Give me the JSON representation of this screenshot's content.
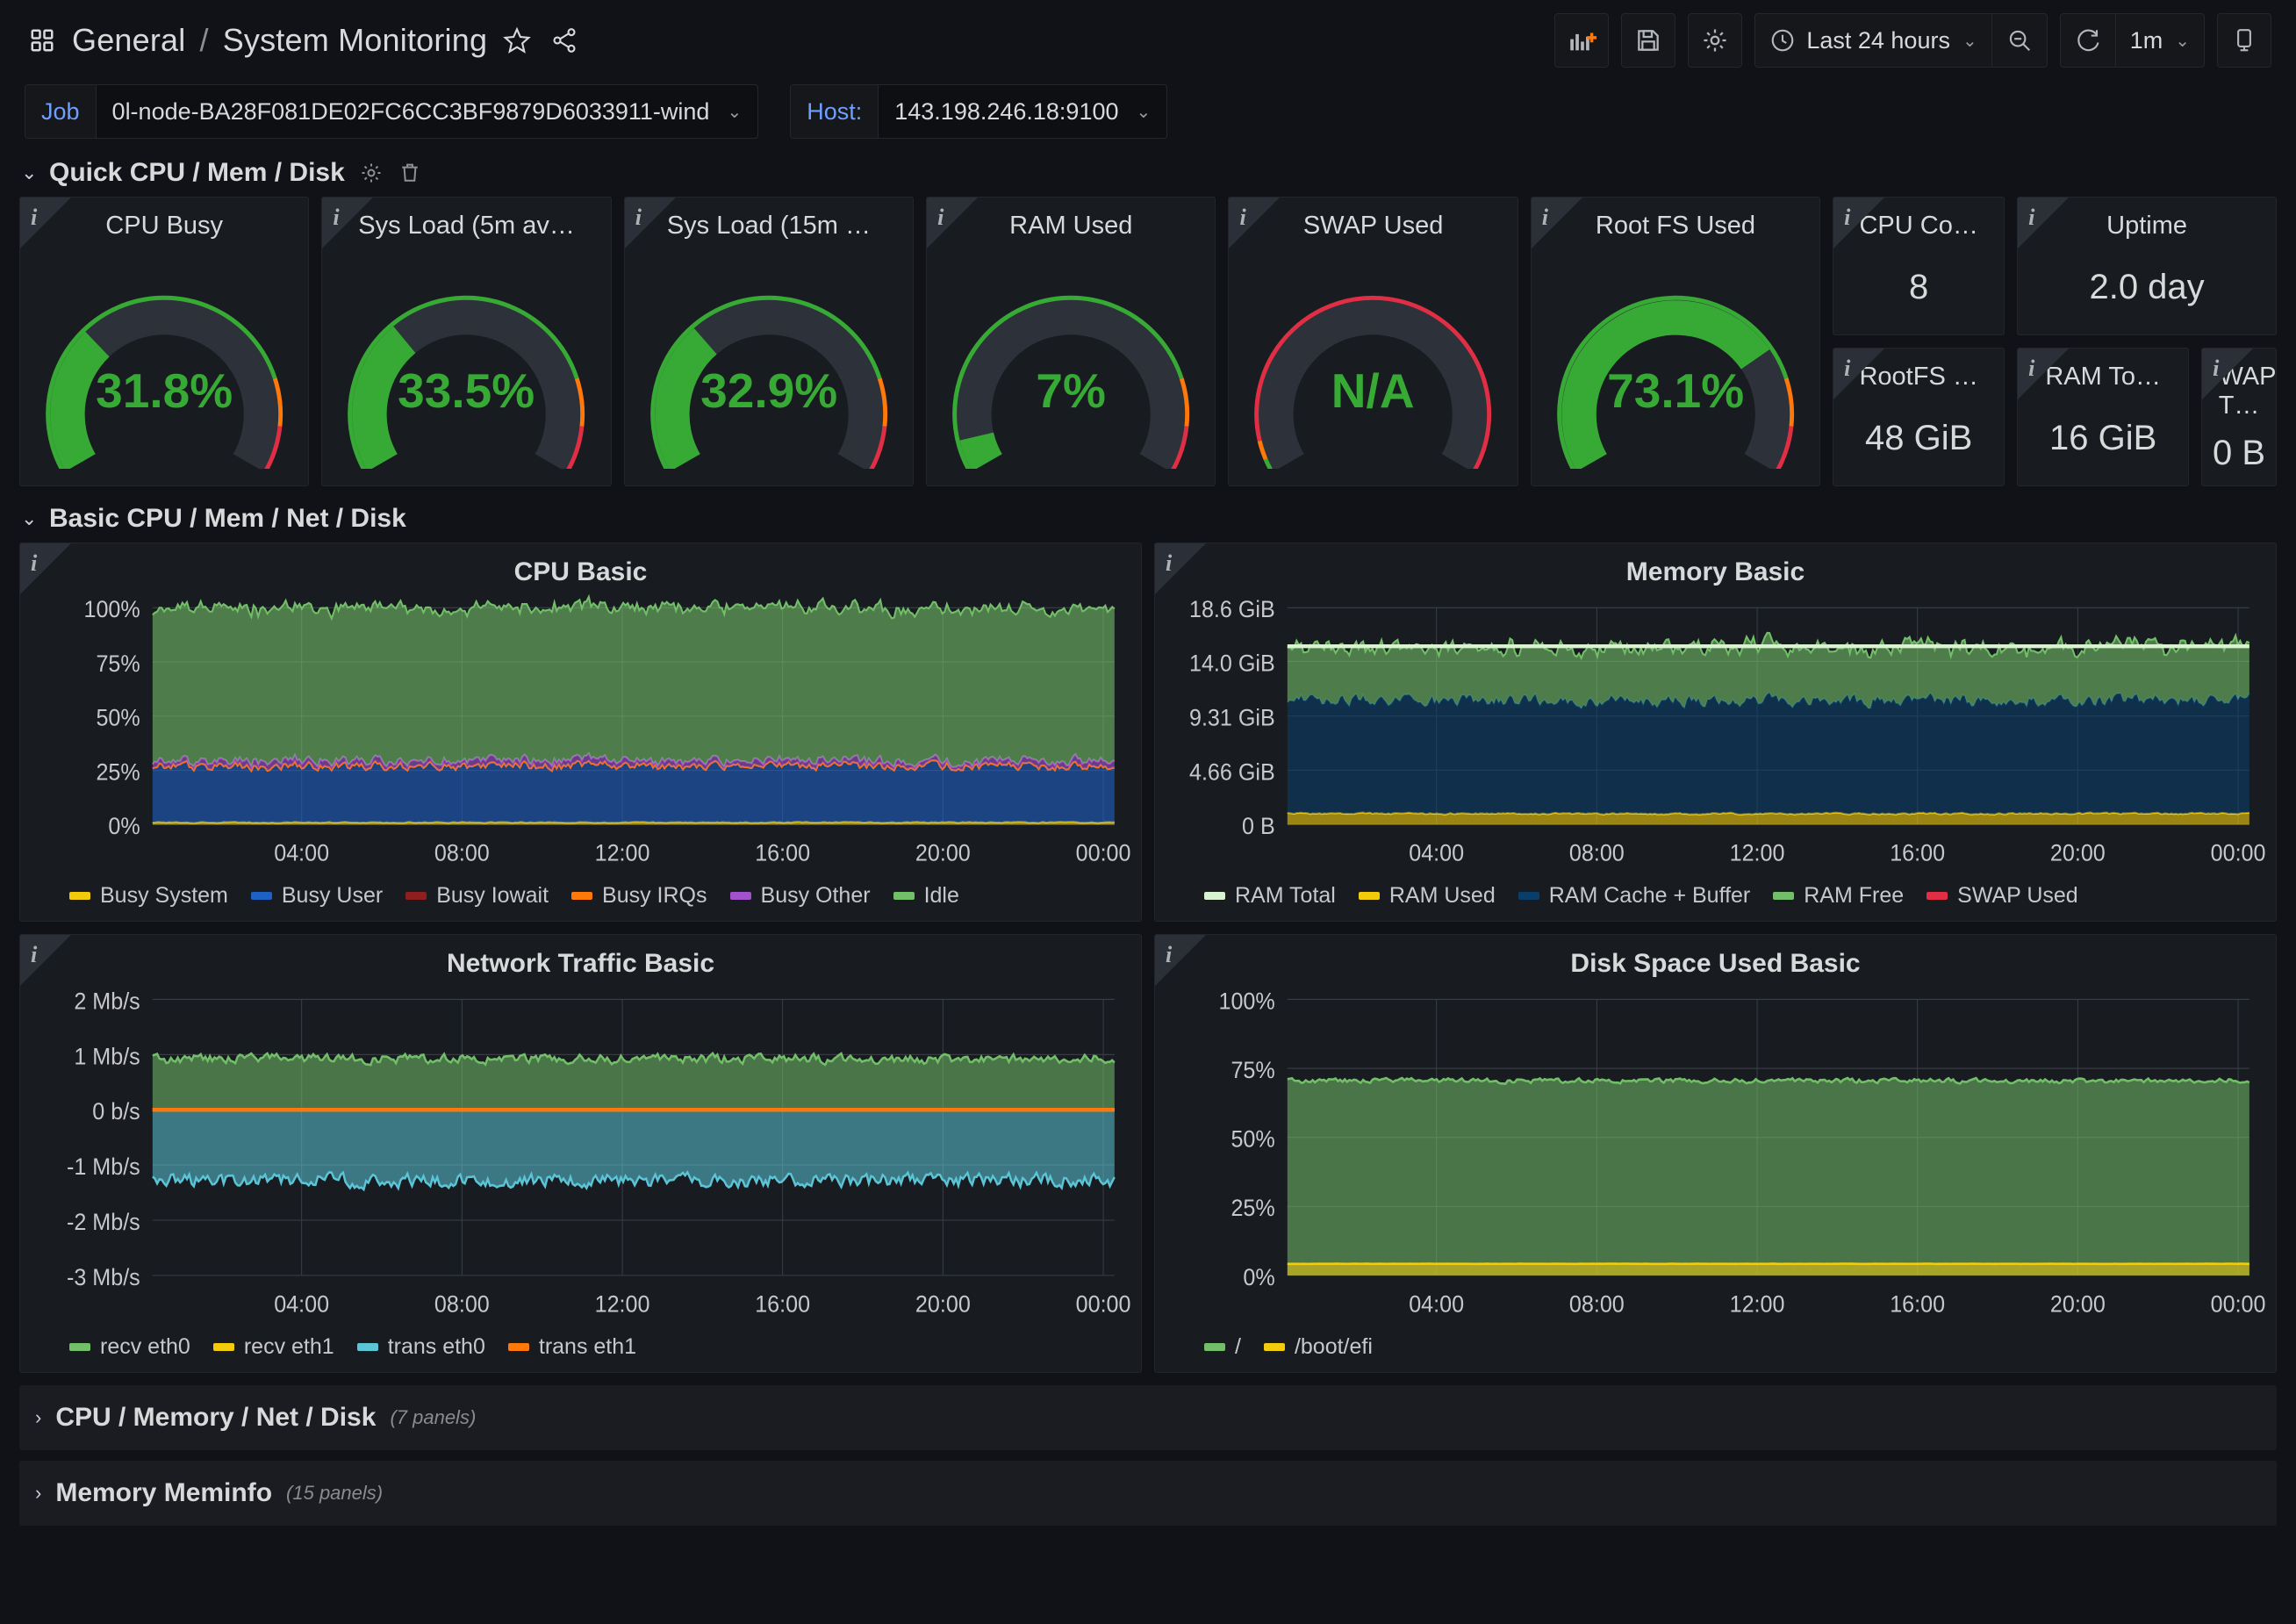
{
  "header": {
    "breadcrumb_root": "General",
    "breadcrumb_sep": "/",
    "breadcrumb_current": "System Monitoring",
    "star_icon": "star-icon",
    "share_icon": "share-icon",
    "dashboard_icon": "dashboard-grid-icon"
  },
  "toolbar": {
    "add_panel_label": "add-panel-icon",
    "save_label": "save-icon",
    "settings_label": "settings-gear-icon",
    "time_range": "Last 24 hours",
    "zoom_out_label": "zoom-out-icon",
    "refresh_label": "refresh-icon",
    "refresh_interval": "1m",
    "tv_label": "tv-mode-icon"
  },
  "variables": [
    {
      "label": "Job",
      "value": "0l-node-BA28F081DE02FC6CC3BF9879D6033911-wind"
    },
    {
      "label": "Host:",
      "value": "143.198.246.18:9100"
    }
  ],
  "rows": {
    "quick": {
      "title": "Quick CPU / Mem / Disk",
      "gear_icon": "gear-icon",
      "trash_icon": "trash-icon"
    },
    "basic": {
      "title": "Basic CPU / Mem / Net / Disk"
    },
    "collapsed": [
      {
        "title": "CPU / Memory / Net / Disk",
        "panels": "(7 panels)"
      },
      {
        "title": "Memory Meminfo",
        "panels": "(15 panels)"
      }
    ]
  },
  "gauges": [
    {
      "title": "CPU Busy",
      "value": "31.8%",
      "pct": 31.8,
      "color": "#37a935",
      "thresholds": "normal"
    },
    {
      "title": "Sys Load (5m av…",
      "value": "33.5%",
      "pct": 33.5,
      "color": "#37a935",
      "thresholds": "normal"
    },
    {
      "title": "Sys Load (15m …",
      "value": "32.9%",
      "pct": 32.9,
      "color": "#37a935",
      "thresholds": "normal"
    },
    {
      "title": "RAM Used",
      "value": "7%",
      "pct": 7.0,
      "color": "#37a935",
      "thresholds": "normal"
    },
    {
      "title": "SWAP Used",
      "value": "N/A",
      "pct": 0,
      "color": "#37a935",
      "thresholds": "swap"
    },
    {
      "title": "Root FS Used",
      "value": "73.1%",
      "pct": 73.1,
      "color": "#37a935",
      "thresholds": "normal"
    }
  ],
  "stats": [
    {
      "title": "CPU Co…",
      "value": "8"
    },
    {
      "title": "Uptime",
      "value": "2.0 day"
    },
    {
      "title": "RootFS …",
      "value": "48 GiB"
    },
    {
      "title": "RAM To…",
      "value": "16 GiB"
    },
    {
      "title": "SWAP T…",
      "value": "0 B"
    }
  ],
  "chart_data": [
    {
      "id": "cpu_basic",
      "type": "area",
      "title": "CPU Basic",
      "stacked": true,
      "xlabel": "",
      "ylabel": "",
      "ylim": [
        0,
        100
      ],
      "yticks": [
        "0%",
        "25%",
        "50%",
        "75%",
        "100%"
      ],
      "ytick_values": [
        0,
        25,
        50,
        75,
        100
      ],
      "xticks": [
        "04:00",
        "08:00",
        "12:00",
        "16:00",
        "20:00",
        "00:00"
      ],
      "grid": true,
      "legend_position": "bottom",
      "series": [
        {
          "name": "Busy System",
          "color": "#f2cc0c",
          "mean": 1.0,
          "amp": 0.4,
          "fill": true
        },
        {
          "name": "Busy User",
          "color": "#1f60c4",
          "mean": 26.0,
          "amp": 3.5,
          "fill": true
        },
        {
          "name": "Busy Iowait",
          "color": "#8f1f1f",
          "mean": 0.1,
          "amp": 0.1,
          "fill": true
        },
        {
          "name": "Busy IRQs",
          "color": "#ff780a",
          "mean": 0.0,
          "amp": 0.0,
          "fill": true
        },
        {
          "name": "Busy Other",
          "color": "#a352cc",
          "mean": 2.4,
          "amp": 1.6,
          "fill": true
        },
        {
          "name": "Idle",
          "color": "#73bf69",
          "mean": 70.5,
          "amp": 3.5,
          "fill": true
        }
      ]
    },
    {
      "id": "memory_basic",
      "type": "area",
      "title": "Memory Basic",
      "stacked": true,
      "xlabel": "",
      "ylabel": "",
      "ylim": [
        0,
        18.6
      ],
      "yticks": [
        "0 B",
        "4.66 GiB",
        "9.31 GiB",
        "14.0 GiB",
        "18.6 GiB"
      ],
      "ytick_values": [
        0,
        4.66,
        9.31,
        14.0,
        18.6
      ],
      "xticks": [
        "04:00",
        "08:00",
        "12:00",
        "16:00",
        "20:00",
        "00:00"
      ],
      "grid": true,
      "legend_position": "bottom",
      "ram_total_line": 15.3,
      "series": [
        {
          "name": "RAM Total",
          "color": "#d9f2d0",
          "mean": 15.3,
          "amp": 0.0,
          "fill": false
        },
        {
          "name": "RAM Used",
          "color": "#f2cc0c",
          "mean": 0.95,
          "amp": 0.12,
          "fill": true
        },
        {
          "name": "RAM Cache + Buffer",
          "color": "#0b3d69",
          "mean": 9.7,
          "amp": 0.85,
          "fill": true
        },
        {
          "name": "RAM Free",
          "color": "#73bf69",
          "mean": 4.6,
          "amp": 0.85,
          "fill": true
        },
        {
          "name": "SWAP Used",
          "color": "#e02f44",
          "mean": 0.0,
          "amp": 0.0,
          "fill": false
        }
      ]
    },
    {
      "id": "network_traffic_basic",
      "type": "area",
      "title": "Network Traffic Basic",
      "stacked": false,
      "xlabel": "",
      "ylabel": "",
      "ylim": [
        -3,
        2
      ],
      "yticks": [
        "-3 Mb/s",
        "-2 Mb/s",
        "-1 Mb/s",
        "0 b/s",
        "1 Mb/s",
        "2 Mb/s"
      ],
      "ytick_values": [
        -3,
        -2,
        -1,
        0,
        1,
        2
      ],
      "xticks": [
        "04:00",
        "08:00",
        "12:00",
        "16:00",
        "20:00",
        "00:00"
      ],
      "grid": true,
      "legend_position": "bottom",
      "series": [
        {
          "name": "recv eth0",
          "color": "#73bf69",
          "mean": 0.92,
          "amp": 0.14,
          "fill": true
        },
        {
          "name": "recv eth1",
          "color": "#f2cc0c",
          "mean": 0.0,
          "amp": 0.0,
          "fill": true
        },
        {
          "name": "trans eth0",
          "color": "#5bc4d6",
          "mean": -1.28,
          "amp": 0.2,
          "fill": true
        },
        {
          "name": "trans eth1",
          "color": "#ff780a",
          "mean": 0.0,
          "amp": 0.0,
          "fill": true
        }
      ]
    },
    {
      "id": "disk_space_used_basic",
      "type": "area",
      "title": "Disk Space Used Basic",
      "stacked": false,
      "xlabel": "",
      "ylabel": "",
      "ylim": [
        0,
        100
      ],
      "yticks": [
        "0%",
        "25%",
        "50%",
        "75%",
        "100%"
      ],
      "ytick_values": [
        0,
        25,
        50,
        75,
        100
      ],
      "xticks": [
        "04:00",
        "08:00",
        "12:00",
        "16:00",
        "20:00",
        "00:00"
      ],
      "grid": true,
      "legend_position": "bottom",
      "series": [
        {
          "name": "/",
          "color": "#73bf69",
          "mean": 70.5,
          "amp": 1.4,
          "fill": true
        },
        {
          "name": "/boot/efi",
          "color": "#f2cc0c",
          "mean": 4.2,
          "amp": 0.05,
          "fill": true
        }
      ]
    }
  ]
}
